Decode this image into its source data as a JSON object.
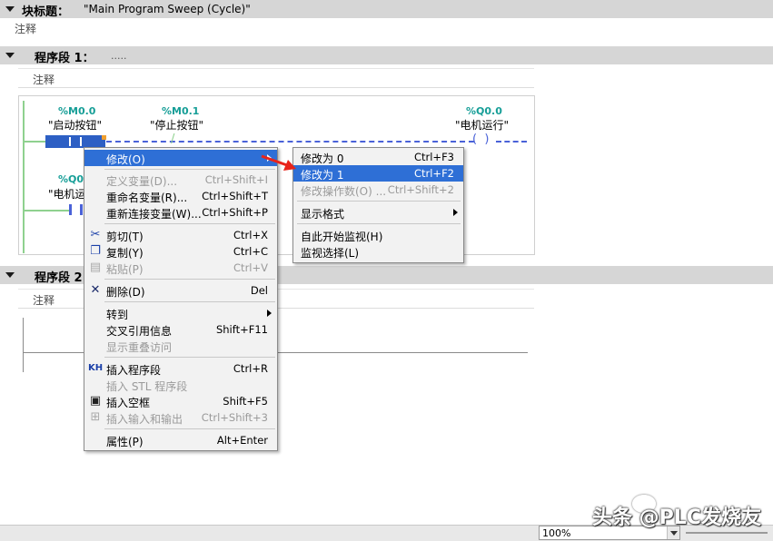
{
  "block": {
    "title_label": "块标题：",
    "title_value": "\"Main Program Sweep (Cycle)\"",
    "comment": "注释"
  },
  "network1": {
    "title": "程序段 1：",
    "dots": ".....",
    "comment": "注释",
    "contacts": [
      {
        "address": "%M0.0",
        "tag": "\"启动按钮\""
      },
      {
        "address": "%M0.1",
        "tag": "\"停止按钮\""
      }
    ],
    "coil": {
      "address": "%Q0.0",
      "tag": "\"电机运行\""
    },
    "branch": {
      "address": "%Q0.",
      "tag": "\"电机运"
    }
  },
  "network2": {
    "title": "程序段 2",
    "comment": "注释"
  },
  "context_menu": {
    "items": [
      {
        "label": "修改(O)",
        "shortcut": "",
        "submenu": true,
        "highlight": true
      },
      {
        "label": "定义变量(D)...",
        "shortcut": "Ctrl+Shift+I",
        "disabled": true
      },
      {
        "label": "重命名变量(R)...",
        "shortcut": "Ctrl+Shift+T"
      },
      {
        "label": "重新连接变量(W)...",
        "shortcut": "Ctrl+Shift+P"
      },
      {
        "label": "剪切(T)",
        "shortcut": "Ctrl+X",
        "icon": "cut-icon"
      },
      {
        "label": "复制(Y)",
        "shortcut": "Ctrl+C",
        "icon": "copy-icon"
      },
      {
        "label": "粘贴(P)",
        "shortcut": "Ctrl+V",
        "icon": "paste-icon",
        "disabled": true
      },
      {
        "label": "删除(D)",
        "shortcut": "Del",
        "icon": "delete-icon"
      },
      {
        "label": "转到",
        "shortcut": "",
        "submenu": true
      },
      {
        "label": "交叉引用信息",
        "shortcut": "Shift+F11"
      },
      {
        "label": "显示重叠访问",
        "shortcut": "",
        "disabled": true
      },
      {
        "label": "插入程序段",
        "shortcut": "Ctrl+R",
        "icon": "insert-network-icon"
      },
      {
        "label": "插入 STL 程序段",
        "shortcut": "",
        "disabled": true
      },
      {
        "label": "插入空框",
        "shortcut": "Shift+F5",
        "icon": "empty-box-icon"
      },
      {
        "label": "插入输入和输出",
        "shortcut": "Ctrl+Shift+3",
        "icon": "insert-io-icon",
        "disabled": true
      },
      {
        "label": "属性(P)",
        "shortcut": "Alt+Enter"
      }
    ]
  },
  "submenu": {
    "items": [
      {
        "label": "修改为 0",
        "shortcut": "Ctrl+F3"
      },
      {
        "label": "修改为 1",
        "shortcut": "Ctrl+F2",
        "highlight": true
      },
      {
        "label": "修改操作数(O) ...",
        "shortcut": "Ctrl+Shift+2",
        "disabled": true
      },
      {
        "label": "显示格式",
        "shortcut": "",
        "submenu": true
      },
      {
        "label": "自此开始监视(H)",
        "shortcut": ""
      },
      {
        "label": "监视选择(L)",
        "shortcut": ""
      }
    ]
  },
  "status": {
    "zoom": "100%"
  },
  "watermark": "头条 @PLC发烧友",
  "colors": {
    "highlight": "#2e6fd6",
    "address": "#169e97",
    "wire_dashed": "#4a62d8",
    "wire_solid": "#8fd18f",
    "arrow": "#e8241b"
  }
}
